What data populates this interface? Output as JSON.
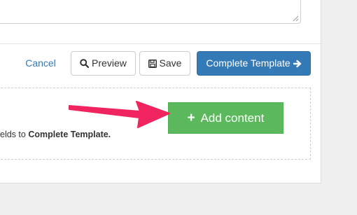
{
  "actions": {
    "cancel_label": "Cancel",
    "preview_label": "Preview",
    "save_label": "Save",
    "complete_label": "Complete Template"
  },
  "content": {
    "hint_prefix": "elds to ",
    "hint_bold": "Complete Template.",
    "add_content_label": "Add content"
  },
  "icons": {
    "preview": "search-icon",
    "save": "floppy-disk-icon",
    "complete": "arrow-right-icon",
    "add": "plus-icon",
    "callout": "callout-arrow"
  },
  "colors": {
    "primary": "#337ab7",
    "success": "#5cb85c",
    "callout": "#f0245f",
    "link": "#337ab7"
  }
}
